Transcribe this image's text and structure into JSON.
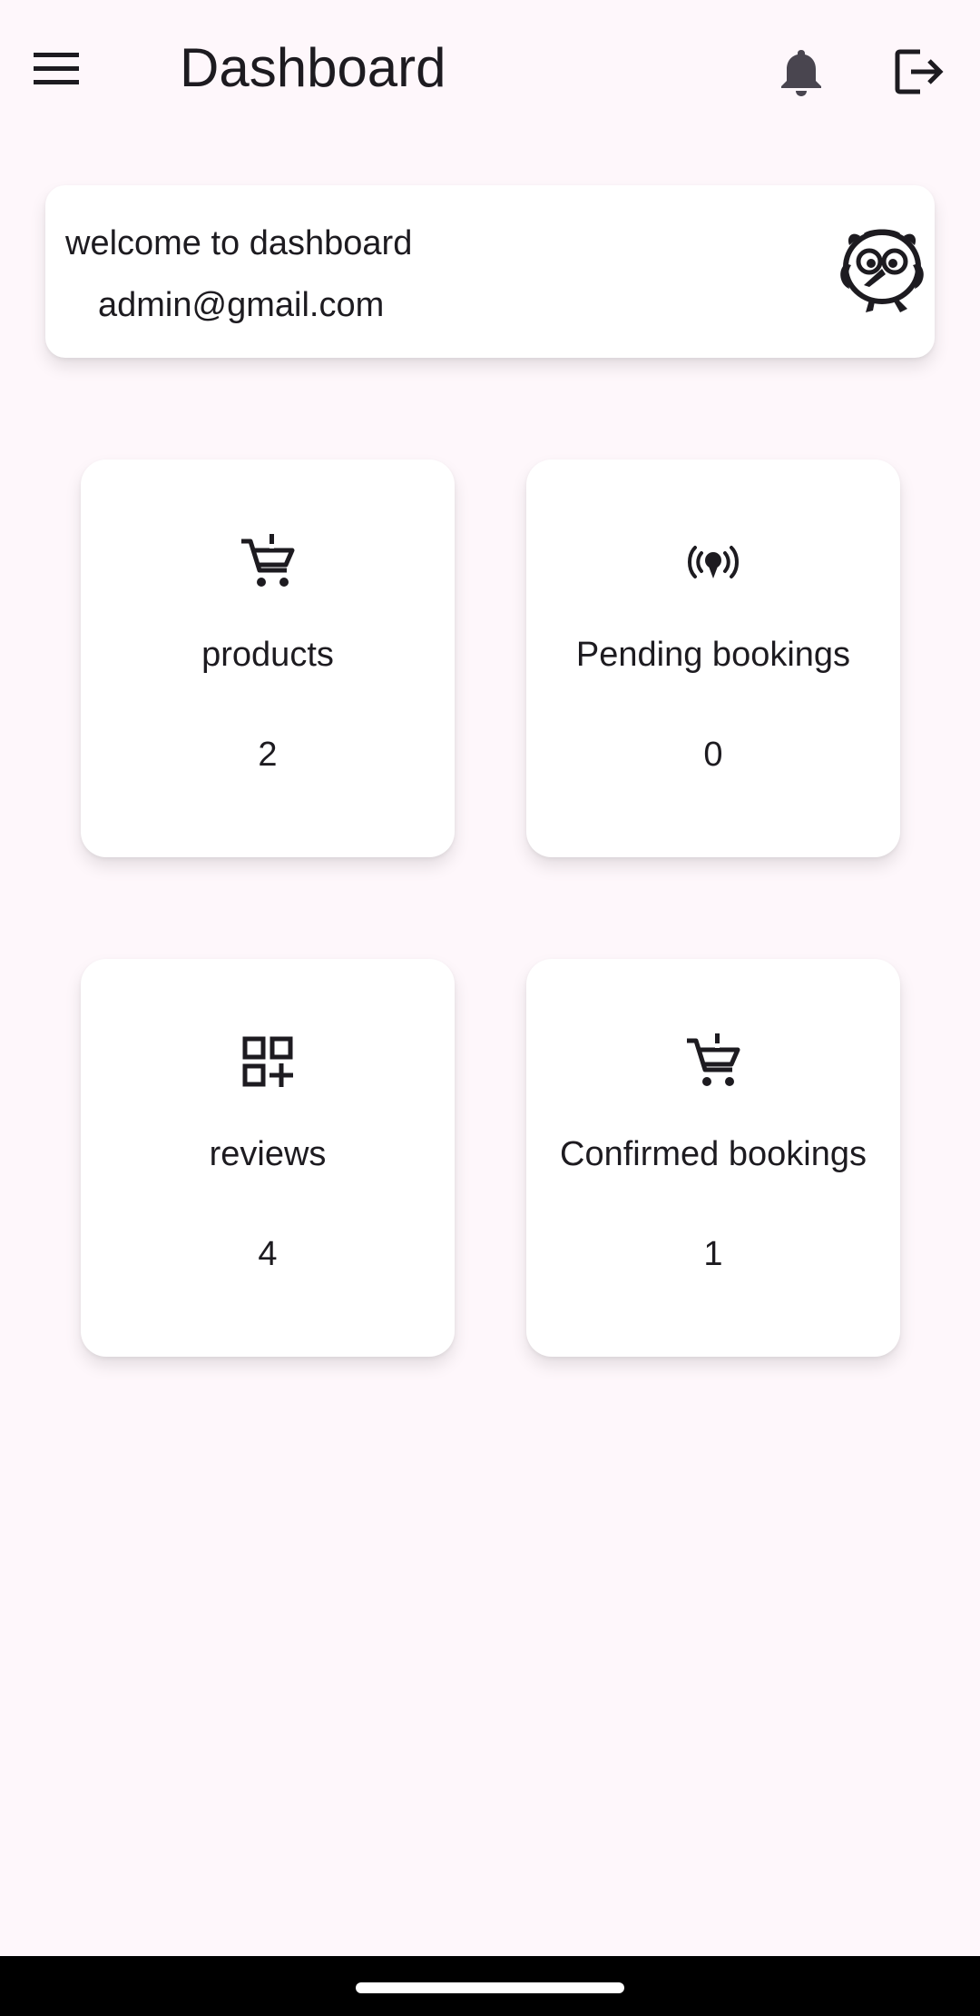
{
  "app_bar": {
    "title": "Dashboard",
    "menu_icon": "menu-icon",
    "bell_icon": "bell-icon",
    "logout_icon": "logout-icon"
  },
  "welcome": {
    "greeting": "welcome to dashboard",
    "email": "admin@gmail.com",
    "avatar_icon": "owl-mascot-icon"
  },
  "cards": {
    "products": {
      "label": "products",
      "value": "2",
      "icon": "cart-alert-icon"
    },
    "pending": {
      "label": "Pending bookings",
      "value": "0",
      "icon": "broadcast-icon"
    },
    "reviews": {
      "label": "reviews",
      "value": "4",
      "icon": "grid-plus-icon"
    },
    "confirmed": {
      "label": "Confirmed bookings",
      "value": "1",
      "icon": "cart-alert-icon"
    }
  },
  "colors": {
    "background": "#fef7fb",
    "card": "#ffffff",
    "text": "#1d1b20",
    "icon": "#1d1b20",
    "nav_bar": "#000000"
  }
}
